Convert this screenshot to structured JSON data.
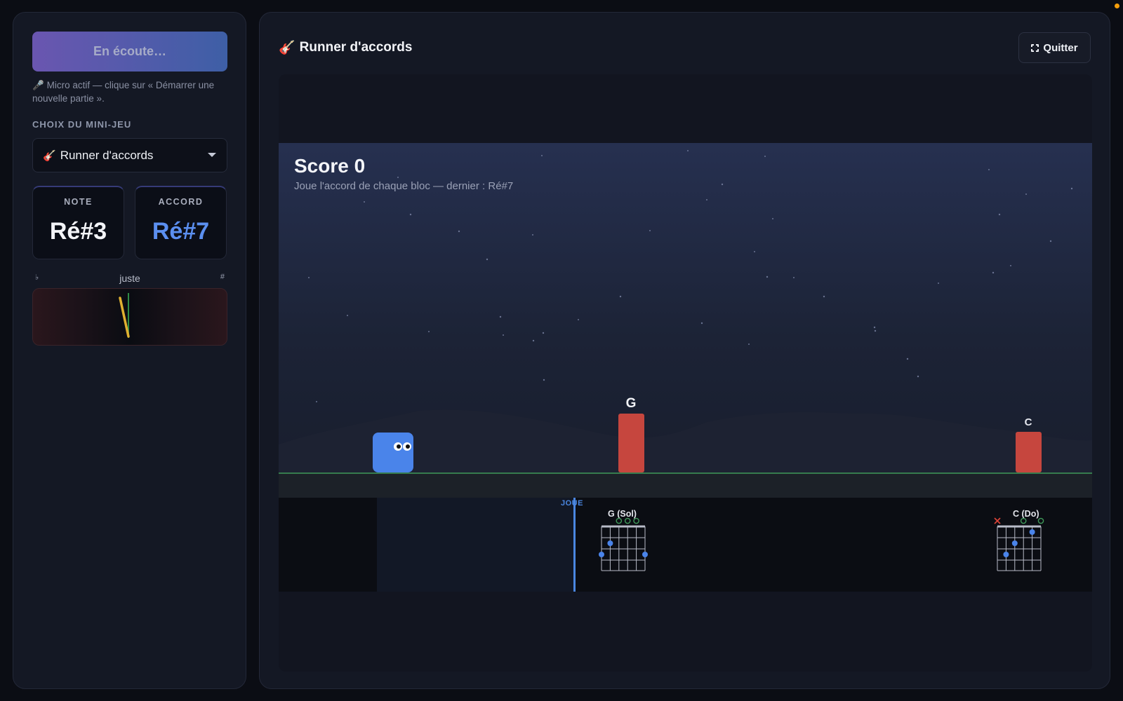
{
  "sidebar": {
    "listen_button": "En écoute…",
    "mic_icon": "🎤",
    "mic_hint": "Micro actif — clique sur « Démarrer une nouvelle partie ».",
    "section_label": "CHOIX DU MINI-JEU",
    "select": {
      "icon": "🎸",
      "value": "Runner d'accords"
    },
    "note_card": {
      "label": "NOTE",
      "value": "Ré#3"
    },
    "chord_card": {
      "label": "ACCORD",
      "value": "Ré#7"
    },
    "tuner": {
      "flat": "♭",
      "center": "juste",
      "sharp": "#"
    }
  },
  "main": {
    "title_icon": "🎸",
    "title": "Runner d'accords",
    "quit_label": "Quitter",
    "score": "Score 0",
    "hint": "Joue l'accord de chaque bloc — dernier : Ré#7",
    "blocks": [
      {
        "label": "G"
      },
      {
        "label": "C"
      }
    ],
    "play_label": "JOUE",
    "chords": [
      {
        "name": "G (Sol)"
      },
      {
        "name": "C (Do)"
      }
    ]
  },
  "colors": {
    "accent": "#5b8ff0",
    "block": "#c6463e",
    "player": "#4a84ea",
    "ground_line": "#3f9a5a"
  }
}
